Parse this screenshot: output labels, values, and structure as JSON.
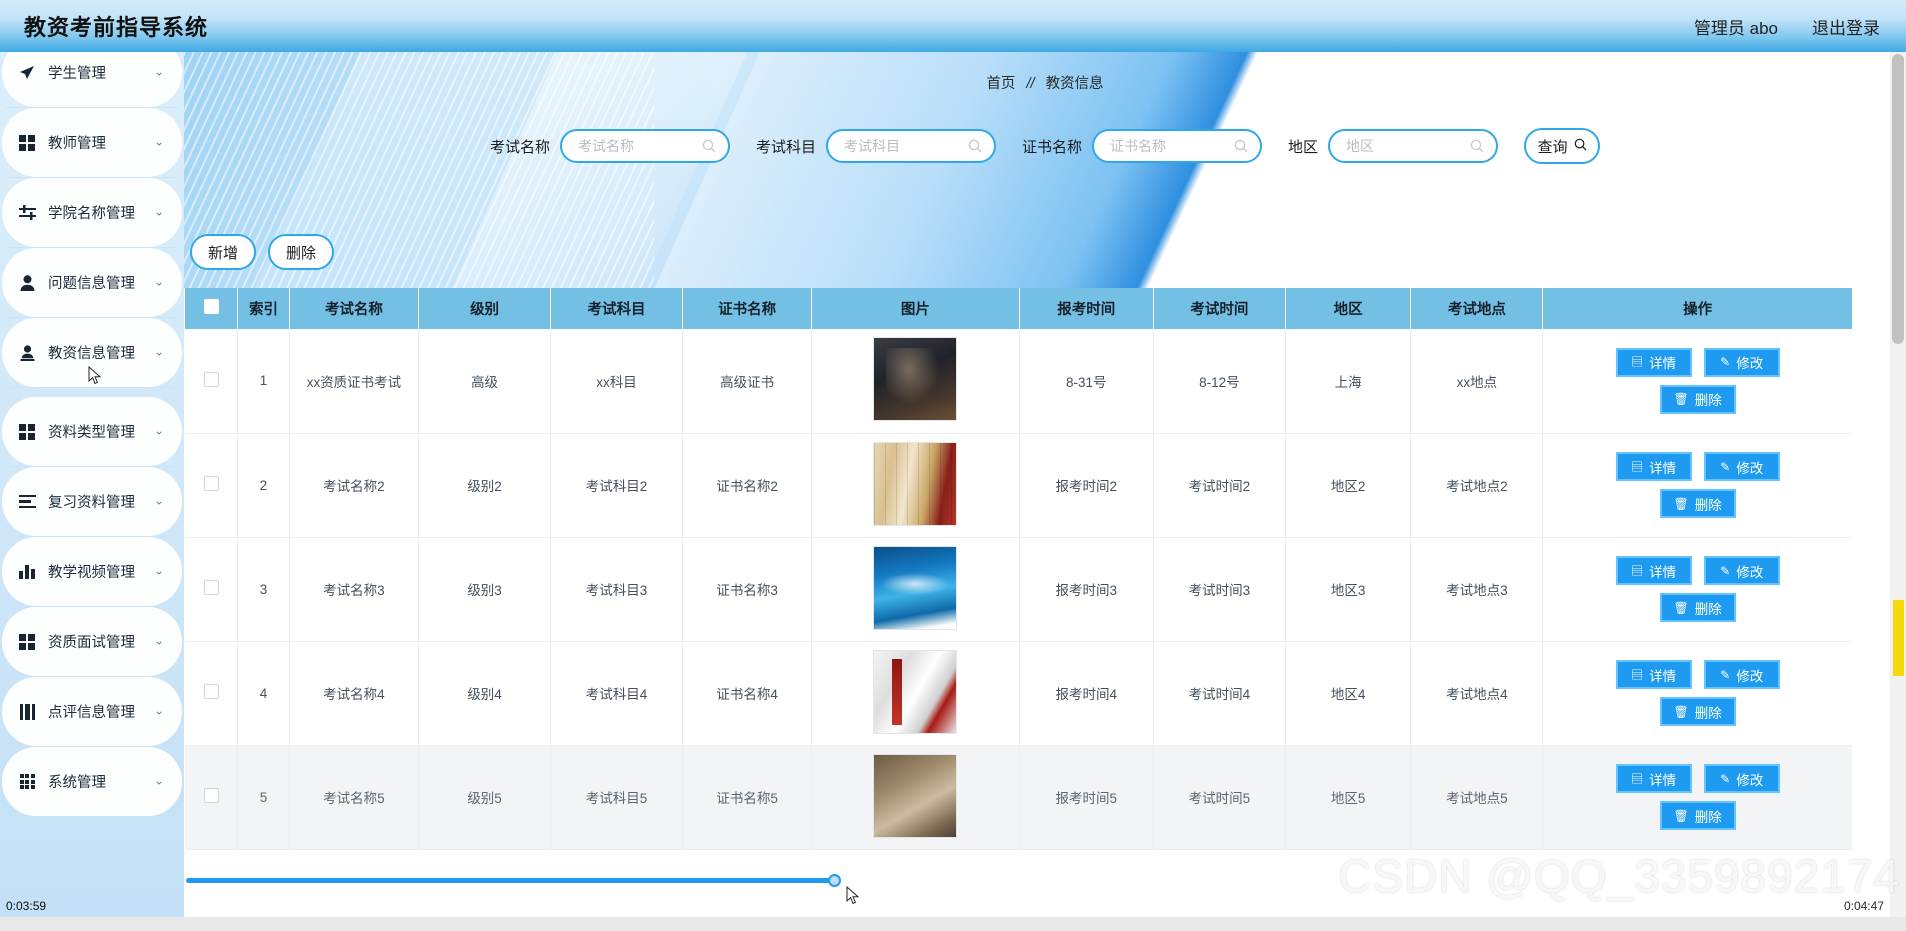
{
  "header": {
    "title": "教资考前指导系统",
    "user_label": "管理员 abo",
    "logout_label": "退出登录"
  },
  "sidebar": {
    "items": [
      {
        "label": "学生管理",
        "icon": "send-icon",
        "chevron": "⌄"
      },
      {
        "label": "教师管理",
        "icon": "grid-icon",
        "chevron": "⌄"
      },
      {
        "label": "学院名称管理",
        "icon": "sliders-icon",
        "chevron": "⌄"
      },
      {
        "label": "问题信息管理",
        "icon": "user-icon",
        "chevron": "⌄"
      },
      {
        "label": "教资信息管理",
        "icon": "user-pin-icon",
        "chevron": "⌄"
      },
      {
        "label": "资料类型管理",
        "icon": "grid-icon",
        "chevron": "⌄"
      },
      {
        "label": "复习资料管理",
        "icon": "list-icon",
        "chevron": "⌄"
      },
      {
        "label": "教学视频管理",
        "icon": "bar-chart-icon",
        "chevron": "⌄"
      },
      {
        "label": "资质面试管理",
        "icon": "grid-icon",
        "chevron": "⌄"
      },
      {
        "label": "点评信息管理",
        "icon": "book-icon",
        "chevron": "⌄"
      },
      {
        "label": "系统管理",
        "icon": "grid9-icon",
        "chevron": "⌄"
      }
    ],
    "timer": "0:03:59"
  },
  "breadcrumb": {
    "home": "首页",
    "separator": "//",
    "current": "教资信息"
  },
  "search": {
    "fields": [
      {
        "label": "考试名称",
        "placeholder": "考试名称",
        "value": ""
      },
      {
        "label": "考试科目",
        "placeholder": "考试科目",
        "value": ""
      },
      {
        "label": "证书名称",
        "placeholder": "证书名称",
        "value": ""
      },
      {
        "label": "地区",
        "placeholder": "地区",
        "value": ""
      }
    ],
    "query_label": "查询"
  },
  "actions": {
    "add_label": "新增",
    "delete_label": "删除"
  },
  "table": {
    "columns": [
      "索引",
      "考试名称",
      "级别",
      "考试科目",
      "证书名称",
      "图片",
      "报考时间",
      "考试时间",
      "地区",
      "考试地点",
      "操作"
    ],
    "row_buttons": {
      "detail": "详情",
      "edit": "修改",
      "delete": "删除"
    },
    "rows": [
      {
        "index": "1",
        "exam_name": "xx资质证书考试",
        "level": "高级",
        "subject": "xx科目",
        "certificate": "高级证书",
        "image": "thumb-1",
        "apply_time": "8-31号",
        "exam_time": "8-12号",
        "region": "上海",
        "place": "xx地点"
      },
      {
        "index": "2",
        "exam_name": "考试名称2",
        "level": "级别2",
        "subject": "考试科目2",
        "certificate": "证书名称2",
        "image": "thumb-2",
        "apply_time": "报考时间2",
        "exam_time": "考试时间2",
        "region": "地区2",
        "place": "考试地点2"
      },
      {
        "index": "3",
        "exam_name": "考试名称3",
        "level": "级别3",
        "subject": "考试科目3",
        "certificate": "证书名称3",
        "image": "thumb-3",
        "apply_time": "报考时间3",
        "exam_time": "考试时间3",
        "region": "地区3",
        "place": "考试地点3"
      },
      {
        "index": "4",
        "exam_name": "考试名称4",
        "level": "级别4",
        "subject": "考试科目4",
        "certificate": "证书名称4",
        "image": "thumb-4",
        "apply_time": "报考时间4",
        "exam_time": "考试时间4",
        "region": "地区4",
        "place": "考试地点4"
      },
      {
        "index": "5",
        "exam_name": "考试名称5",
        "level": "级别5",
        "subject": "考试科目5",
        "certificate": "证书名称5",
        "image": "thumb-5",
        "apply_time": "报考时间5",
        "exam_time": "考试时间5",
        "region": "地区5",
        "place": "考试地点5"
      }
    ]
  },
  "overlay": {
    "watermark": "CSDN @QQ_3359892174",
    "corner_timer": "0:04:47"
  },
  "colors": {
    "brand_blue": "#1e9bf0",
    "header_blue": "#3fa9e4",
    "table_header": "#74c0e4",
    "field_border": "#2fa8e8",
    "highlight_yellow": "#f5d90a"
  }
}
